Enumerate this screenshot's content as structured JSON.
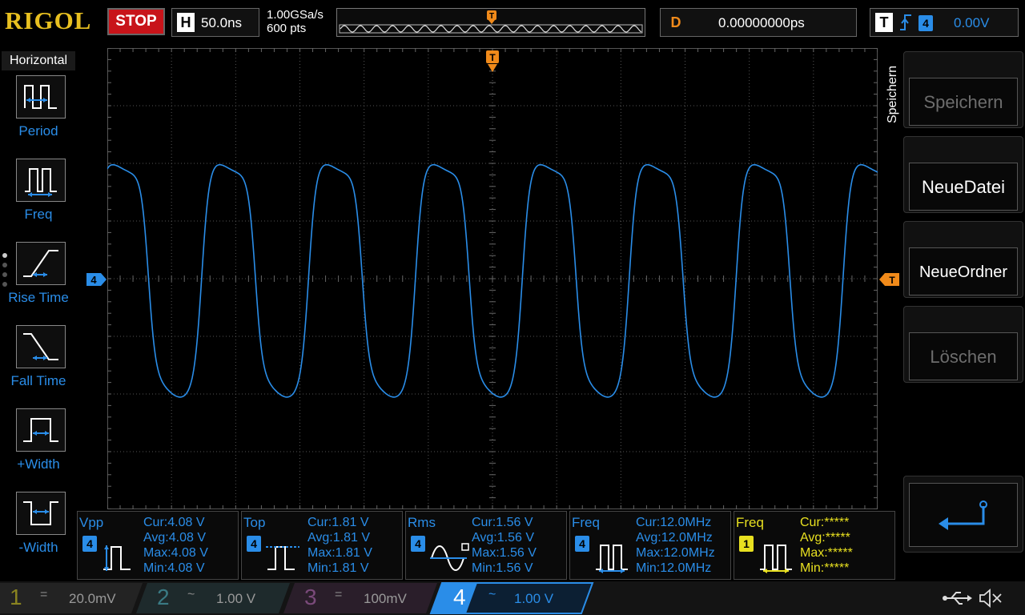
{
  "top": {
    "logo": "RIGOL",
    "run_state": "STOP",
    "horizontal": {
      "letter": "H",
      "value": "50.0ns"
    },
    "sample": {
      "rate": "1.00GSa/s",
      "points": "600 pts"
    },
    "delay": {
      "letter": "D",
      "value": "0.00000000ps"
    },
    "trigger": {
      "letter": "T",
      "channel": "4",
      "level": "0.00V"
    }
  },
  "left_menu": {
    "title": "Horizontal",
    "items": [
      {
        "label": "Period"
      },
      {
        "label": "Freq"
      },
      {
        "label": "Rise Time"
      },
      {
        "label": "Fall Time"
      },
      {
        "label": "+Width"
      },
      {
        "label": "-Width"
      }
    ]
  },
  "right_menu": {
    "title": "Speichern",
    "buttons": [
      {
        "label": "Speichern"
      },
      {
        "label": "NeueDatei"
      },
      {
        "label": "NeueOrdner"
      },
      {
        "label": "Löschen"
      }
    ]
  },
  "markers": {
    "channel_label": "4",
    "trigger_label": "T"
  },
  "measurements": [
    {
      "name": "Vpp",
      "channel": "4",
      "cur": "Cur:4.08 V",
      "avg": "Avg:4.08 V",
      "max": "Max:4.08 V",
      "min": "Min:4.08 V"
    },
    {
      "name": "Top",
      "channel": "4",
      "cur": "Cur:1.81 V",
      "avg": "Avg:1.81 V",
      "max": "Max:1.81 V",
      "min": "Min:1.81 V"
    },
    {
      "name": "Rms",
      "channel": "4",
      "cur": "Cur:1.56 V",
      "avg": "Avg:1.56 V",
      "max": "Max:1.56 V",
      "min": "Min:1.56 V"
    },
    {
      "name": "Freq",
      "channel": "4",
      "cur": "Cur:12.0MHz",
      "avg": "Avg:12.0MHz",
      "max": "Max:12.0MHz",
      "min": "Min:12.0MHz"
    },
    {
      "name": "Freq",
      "channel": "1",
      "cur": "Cur:*****",
      "avg": "Avg:*****",
      "max": "Max:*****",
      "min": "Min:*****"
    }
  ],
  "channels": [
    {
      "num": "1",
      "coupling": "=",
      "scale": "20.0mV",
      "color": "#b8b020"
    },
    {
      "num": "2",
      "coupling": "~",
      "scale": "1.00 V",
      "color": "#20b8c8"
    },
    {
      "num": "3",
      "coupling": "=",
      "scale": "100mV",
      "color": "#c040c0"
    },
    {
      "num": "4",
      "coupling": "~",
      "scale": "1.00 V",
      "color": "#2a8de8"
    }
  ],
  "colors": {
    "ch4": "#2a8de8",
    "ch1": "#e8e020",
    "trigger": "#f08a1a",
    "stop": "#c8141a"
  },
  "icons": [
    "usb-icon",
    "mute-speaker-icon"
  ]
}
